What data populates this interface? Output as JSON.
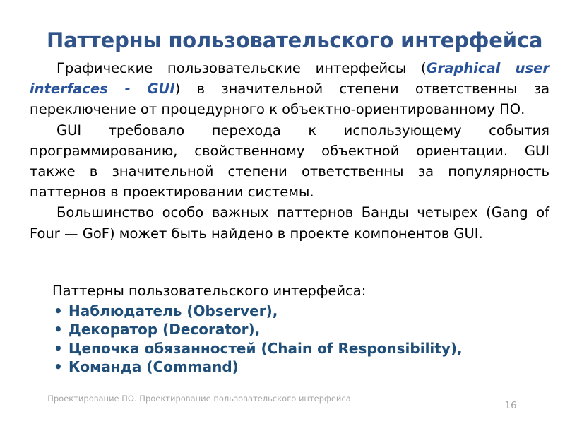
{
  "slide": {
    "title": "Паттерны пользовательского интерфейса",
    "title_color": "#30538A",
    "background_color": "#FFFFFF"
  },
  "body": {
    "paragraph_1": {
      "prefix": "Графические пользовательские интерфейсы (",
      "highlight": "Graphical user interfaces - GUI",
      "suffix": ") в значительной степени ответственны за переключение от процедурного к объектно-ориентированному ПО.",
      "highlight_color": "#29539B"
    },
    "paragraph_2": "GUI требовало перехода к использующему события программированию, свойственному объектной ориентации. GUI также в значительной степени ответственны за популярность паттернов в проектировании системы.",
    "paragraph_3": "Большинство особо важных паттернов Банды четырех (Gang of Four — GoF) может быть найдено в проекте компонентов GUI."
  },
  "list_section": {
    "intro": "Паттерны пользовательского интерфейса:",
    "bullet_glyph": "•",
    "item_color": "#1F4E79",
    "items": [
      "Наблюдатель (Observer),",
      "Декоратор (Decorator),",
      "Цепочка обязанностей (Chain of Responsibility),",
      "Команда (Command)"
    ]
  },
  "footer": {
    "text": "Проектирование ПО. Проектирование пользовательского интерфейса",
    "page_number": "16",
    "color": "#A6A6A6"
  }
}
